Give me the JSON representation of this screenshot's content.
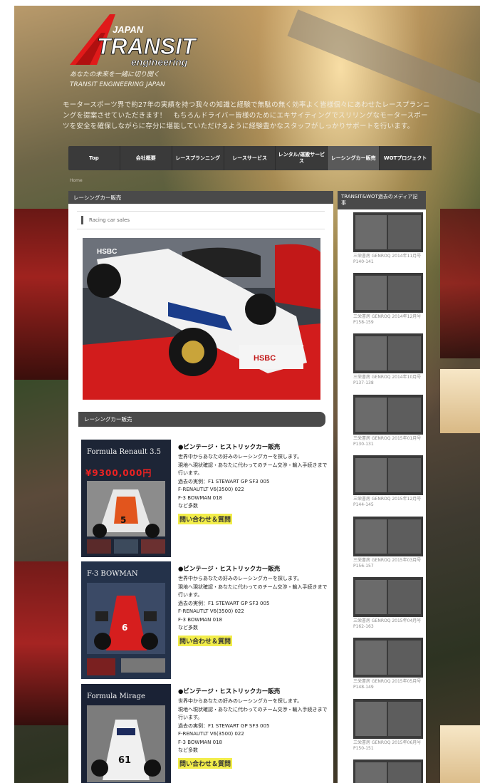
{
  "brand": {
    "japan": "JAPAN",
    "name": "TRANSIT",
    "engineering": "engineering",
    "accent": "#e01a1a"
  },
  "tagline": {
    "line1": "あなたの未来を一緒に切り開く",
    "line2": "TRANSIT ENGINEERING JAPAN"
  },
  "intro": "モータースポーツ界で約27年の実績を持つ我々の知識と経験で無駄の無く効率よく皆様個々にあわせたレースプランニングを提案させていただきます！　もちろんドライバー皆様のためにエキサイティングでスリリングなモータースポーツを安全を確保しながらに存分に堪能していただけるように経験豊かなスタッフがしっかりサポートを行います。",
  "nav": [
    "Top",
    "会社概要",
    "レースプランニング",
    "レースサービス",
    "レンタル/運搬サービス",
    "レーシングカー販売",
    "WOTプロジェクト"
  ],
  "nav_active_index": 5,
  "breadcrumb": "Home",
  "main": {
    "title": "レーシングカー販売",
    "subheading": "Racing car sales",
    "section_title": "レーシングカー販売"
  },
  "products": [
    {
      "thumb_title": "Formula Renault 3.5",
      "thumb_price": "¥9300,000円",
      "car_number": "5",
      "heading": "●ビンテージ・ヒストリックカー販売",
      "body": [
        "世界中からあなたの好みのレーシングカーを探します。",
        "現地へ現状確認・あなたに代わってのチーム交渉・輸入手続きまで行います。",
        "過去の実例：F1 STEWART GP SF3 005",
        "F-RENAUTLT V6(3500) 022",
        "F-3 BOWMAN 018",
        "など多数"
      ],
      "cta": "問い合わせ＆質問"
    },
    {
      "thumb_title": "F-3 BOWMAN",
      "thumb_price": "",
      "car_number": "6",
      "heading": "●ビンテージ・ヒストリックカー販売",
      "body": [
        "世界中からあなたの好みのレーシングカーを探します。",
        "現地へ現状確認・あなたに代わってのチーム交渉・輸入手続きまで行います。",
        "過去の実例：F1 STEWART GP SF3 005",
        "F-RENAUTLT V6(3500) 022",
        "F-3 BOWMAN 018",
        "など多数"
      ],
      "cta": "問い合わせ＆質問"
    },
    {
      "thumb_title": "Formula Mirage",
      "thumb_price": "",
      "car_number": "61",
      "heading": "●ビンテージ・ヒストリックカー販売",
      "body": [
        "世界中からあなたの好みのレーシングカーを探します。",
        "現地へ現状確認・あなたに代わってのチーム交渉・輸入手続きまで行います。",
        "過去の実例：F1 STEWART GP SF3 005",
        "F-RENAUTLT V6(3500) 022",
        "F-3 BOWMAN 018",
        "など多数"
      ],
      "cta": "問い合わせ＆質問"
    }
  ],
  "sidebar": {
    "title": "TRANSIT&WOT過去のメディア記事",
    "articles": [
      {
        "caption": "三栄書房 GENROQ 2014年11月号 P140-141"
      },
      {
        "caption": "三栄書房 GENROQ 2014年12月号 P158-159"
      },
      {
        "caption": "三栄書房 GENROQ 2014年10月号 P137-138"
      },
      {
        "caption": "三栄書房 GENROQ 2015年01月号 P130-131"
      },
      {
        "caption": "三栄書房 GENROQ 2015年12月号 P144-145"
      },
      {
        "caption": "三栄書房 GENROQ 2015年03月号 P156-157"
      },
      {
        "caption": "三栄書房 GENROQ 2015年04月号 P162-163"
      },
      {
        "caption": "三栄書房 GENROQ 2015年05月号 P148-149"
      },
      {
        "caption": "三栄書房 GENROQ 2015年06月号 P150-151"
      },
      {
        "caption": ""
      }
    ]
  }
}
